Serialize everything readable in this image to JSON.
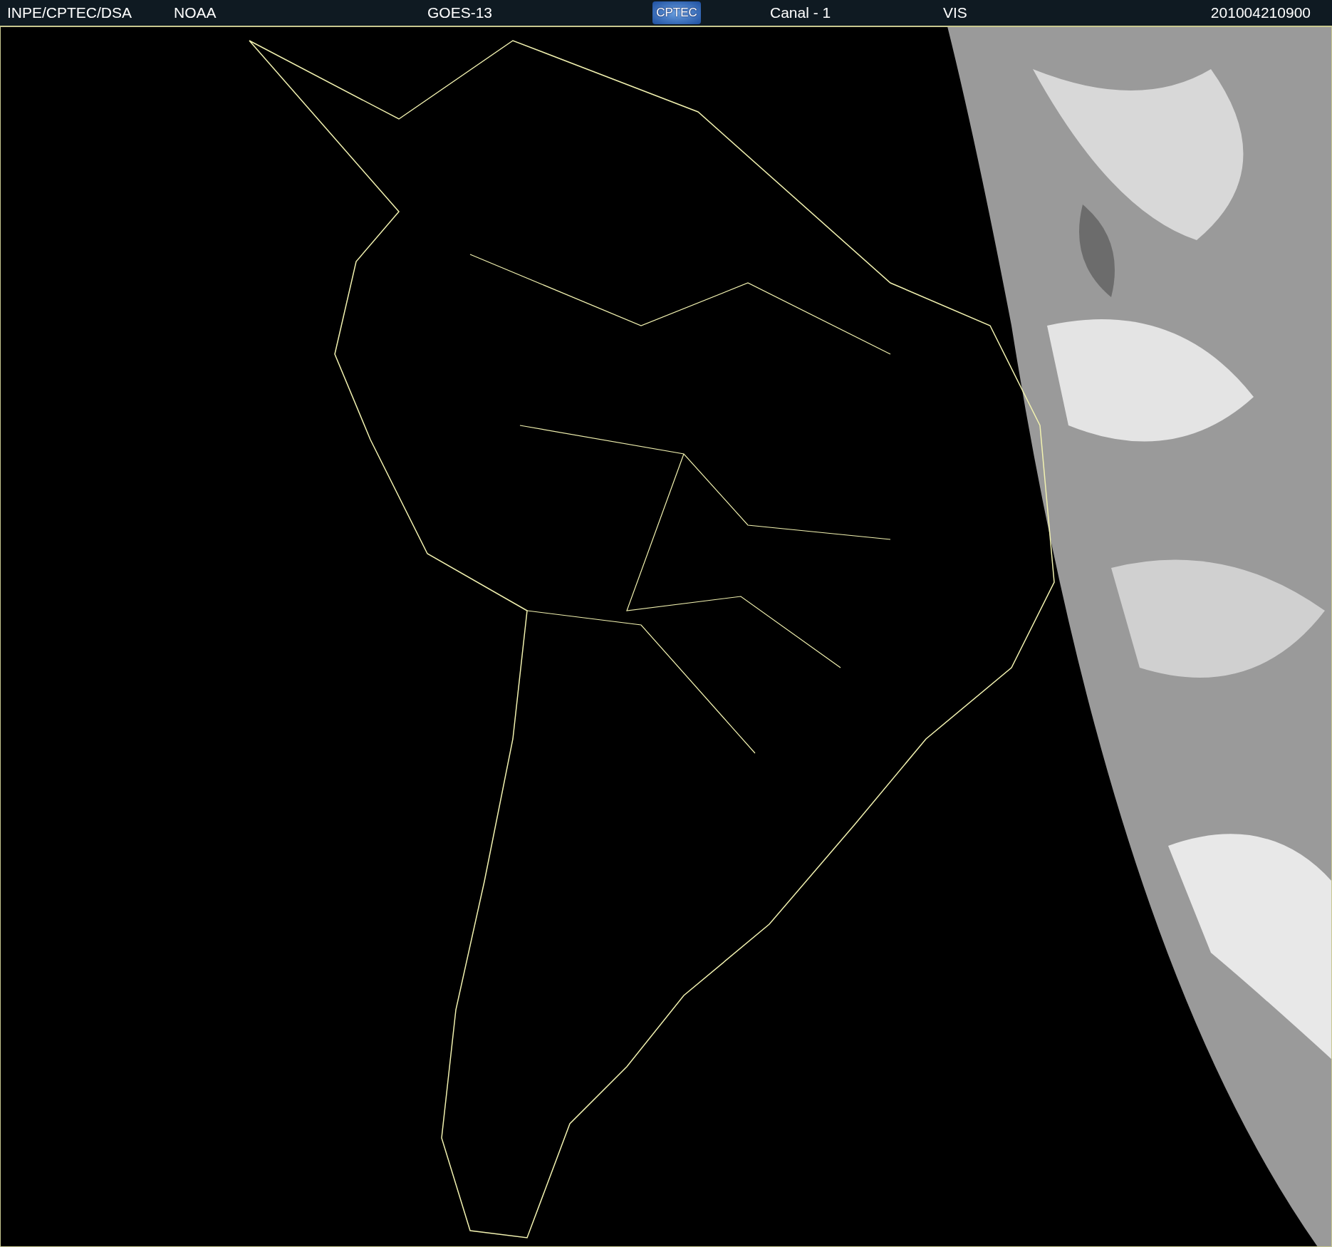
{
  "header": {
    "source": "INPE/CPTEC/DSA",
    "agency": "NOAA",
    "satellite": "GOES-13",
    "logo": "CPTEC",
    "channel": "Canal - 1",
    "band": "VIS",
    "timestamp": "201004210900"
  }
}
